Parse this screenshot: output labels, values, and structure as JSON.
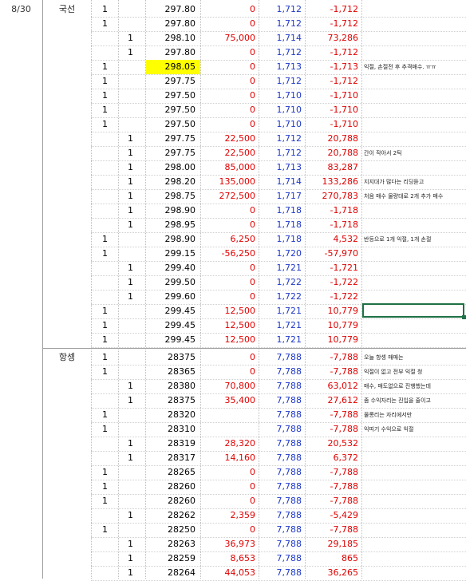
{
  "sheet": {
    "date": "8/30",
    "sections": [
      {
        "product": "국선",
        "rows": [
          {
            "c1": "1",
            "c2": "",
            "price": "297.80",
            "pnl": "0",
            "comm": "1,712",
            "net": "-1,712",
            "note": ""
          },
          {
            "c1": "1",
            "c2": "",
            "price": "297.80",
            "pnl": "0",
            "comm": "1,712",
            "net": "-1,712",
            "note": ""
          },
          {
            "c1": "",
            "c2": "1",
            "price": "298.10",
            "pnl": "75,000",
            "comm": "1,714",
            "net": "73,286",
            "note": ""
          },
          {
            "c1": "",
            "c2": "1",
            "price": "297.80",
            "pnl": "0",
            "comm": "1,712",
            "net": "-1,712",
            "note": ""
          },
          {
            "c1": "1",
            "c2": "",
            "price": "298.05",
            "pnl": "0",
            "comm": "1,713",
            "net": "-1,713",
            "note": "익절, 손절전 후 추격매수. ㅠㅠ",
            "highlight": true
          },
          {
            "c1": "1",
            "c2": "",
            "price": "297.75",
            "pnl": "0",
            "comm": "1,712",
            "net": "-1,712",
            "note": ""
          },
          {
            "c1": "1",
            "c2": "",
            "price": "297.50",
            "pnl": "0",
            "comm": "1,710",
            "net": "-1,710",
            "note": ""
          },
          {
            "c1": "1",
            "c2": "",
            "price": "297.50",
            "pnl": "0",
            "comm": "1,710",
            "net": "-1,710",
            "note": ""
          },
          {
            "c1": "1",
            "c2": "",
            "price": "297.50",
            "pnl": "0",
            "comm": "1,710",
            "net": "-1,710",
            "note": ""
          },
          {
            "c1": "",
            "c2": "1",
            "price": "297.75",
            "pnl": "22,500",
            "comm": "1,712",
            "net": "20,788",
            "note": ""
          },
          {
            "c1": "",
            "c2": "1",
            "price": "297.75",
            "pnl": "22,500",
            "comm": "1,712",
            "net": "20,788",
            "note": "간이 작아서 2틱"
          },
          {
            "c1": "",
            "c2": "1",
            "price": "298.00",
            "pnl": "85,000",
            "comm": "1,713",
            "net": "83,287",
            "note": ""
          },
          {
            "c1": "",
            "c2": "1",
            "price": "298.20",
            "pnl": "135,000",
            "comm": "1,714",
            "net": "133,286",
            "note": "지지대가 많다는 리딩듣고"
          },
          {
            "c1": "",
            "c2": "1",
            "price": "298.75",
            "pnl": "272,500",
            "comm": "1,717",
            "net": "270,783",
            "note": "처음 매수 물량대로 2개 추가 매수"
          },
          {
            "c1": "",
            "c2": "1",
            "price": "298.90",
            "pnl": "0",
            "comm": "1,718",
            "net": "-1,718",
            "note": ""
          },
          {
            "c1": "",
            "c2": "1",
            "price": "298.95",
            "pnl": "0",
            "comm": "1,718",
            "net": "-1,718",
            "note": ""
          },
          {
            "c1": "1",
            "c2": "",
            "price": "298.90",
            "pnl": "6,250",
            "comm": "1,718",
            "net": "4,532",
            "note": "반등으로 1개 익절, 1개 손절"
          },
          {
            "c1": "1",
            "c2": "",
            "price": "299.15",
            "pnl": "-56,250",
            "comm": "1,720",
            "net": "-57,970",
            "note": ""
          },
          {
            "c1": "",
            "c2": "1",
            "price": "299.40",
            "pnl": "0",
            "comm": "1,721",
            "net": "-1,721",
            "note": ""
          },
          {
            "c1": "",
            "c2": "1",
            "price": "299.50",
            "pnl": "0",
            "comm": "1,722",
            "net": "-1,722",
            "note": ""
          },
          {
            "c1": "",
            "c2": "1",
            "price": "299.60",
            "pnl": "0",
            "comm": "1,722",
            "net": "-1,722",
            "note": ""
          },
          {
            "c1": "1",
            "c2": "",
            "price": "299.45",
            "pnl": "12,500",
            "comm": "1,721",
            "net": "10,779",
            "note": ""
          },
          {
            "c1": "1",
            "c2": "",
            "price": "299.45",
            "pnl": "12,500",
            "comm": "1,721",
            "net": "10,779",
            "note": ""
          },
          {
            "c1": "1",
            "c2": "",
            "price": "299.45",
            "pnl": "12,500",
            "comm": "1,721",
            "net": "10,779",
            "note": ""
          }
        ]
      },
      {
        "product": "항셍",
        "rows": [
          {
            "c1": "1",
            "c2": "",
            "price": "28375",
            "pnl": "0",
            "comm": "7,788",
            "net": "-7,788",
            "note": "오늘 항셍 매매는"
          },
          {
            "c1": "1",
            "c2": "",
            "price": "28365",
            "pnl": "0",
            "comm": "7,788",
            "net": "-7,788",
            "note": "익절이 없고 전부 익절 청"
          },
          {
            "c1": "",
            "c2": "1",
            "price": "28380",
            "pnl": "70,800",
            "comm": "7,788",
            "net": "63,012",
            "note": "매수, 매도없으로 진행했는데"
          },
          {
            "c1": "",
            "c2": "1",
            "price": "28375",
            "pnl": "35,400",
            "comm": "7,788",
            "net": "27,612",
            "note": "좀 수익자리는 진입을 줄이고"
          },
          {
            "c1": "1",
            "c2": "",
            "price": "28320",
            "pnl": "",
            "comm": "7,788",
            "net": "-7,788",
            "note": "물롱리는 자리에서만"
          },
          {
            "c1": "1",
            "c2": "",
            "price": "28310",
            "pnl": "",
            "comm": "7,788",
            "net": "-7,788",
            "note": "익띠기 수익으로 익절"
          },
          {
            "c1": "",
            "c2": "1",
            "price": "28319",
            "pnl": "28,320",
            "comm": "7,788",
            "net": "20,532",
            "note": ""
          },
          {
            "c1": "",
            "c2": "1",
            "price": "28317",
            "pnl": "14,160",
            "comm": "7,788",
            "net": "6,372",
            "note": ""
          },
          {
            "c1": "1",
            "c2": "",
            "price": "28265",
            "pnl": "0",
            "comm": "7,788",
            "net": "-7,788",
            "note": ""
          },
          {
            "c1": "1",
            "c2": "",
            "price": "28260",
            "pnl": "0",
            "comm": "7,788",
            "net": "-7,788",
            "note": ""
          },
          {
            "c1": "1",
            "c2": "",
            "price": "28260",
            "pnl": "0",
            "comm": "7,788",
            "net": "-7,788",
            "note": ""
          },
          {
            "c1": "",
            "c2": "1",
            "price": "28262",
            "pnl": "2,359",
            "comm": "7,788",
            "net": "-5,429",
            "note": ""
          },
          {
            "c1": "1",
            "c2": "",
            "price": "28250",
            "pnl": "0",
            "comm": "7,788",
            "net": "-7,788",
            "note": ""
          },
          {
            "c1": "",
            "c2": "1",
            "price": "28263",
            "pnl": "36,973",
            "comm": "7,788",
            "net": "29,185",
            "note": ""
          },
          {
            "c1": "",
            "c2": "1",
            "price": "28259",
            "pnl": "8,653",
            "comm": "7,788",
            "net": "865",
            "note": ""
          },
          {
            "c1": "",
            "c2": "1",
            "price": "28264",
            "pnl": "44,053",
            "comm": "7,788",
            "net": "36,265",
            "note": ""
          }
        ]
      }
    ],
    "colors": {
      "profit_text": "#e00000",
      "commission_text": "#1f39c8",
      "highlight": "#ffff00",
      "selection_border": "#1e7145",
      "grid": "#bdbdbd"
    }
  }
}
